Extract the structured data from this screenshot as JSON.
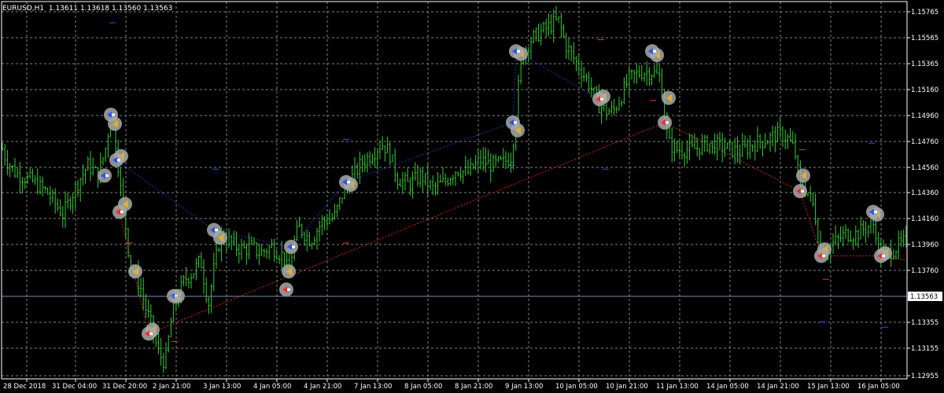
{
  "header": {
    "symbol": "EURUSD,H1",
    "ohlc": "1.13611 1.13618 1.13560 1.13563"
  },
  "colors": {
    "background": "#000000",
    "grid": "#7f7f7f",
    "frame": "#ffffff",
    "candle": "#33cc33",
    "current_price_line": "#7f8fa8",
    "buy_marker": "#2255ff",
    "sell_marker": "#ff2a2a",
    "badge": "#a9a9a9",
    "buy_trend": "#2233aa",
    "sell_trend": "#cc2222"
  },
  "chart_data": {
    "type": "candlestick",
    "title": "",
    "xlabel": "",
    "ylabel": "",
    "ylim": [
      1.1295,
      1.1585
    ],
    "y_ticks": [
      "1.15765",
      "1.15565",
      "1.15365",
      "1.15160",
      "1.14960",
      "1.14760",
      "1.14560",
      "1.14360",
      "1.14160",
      "1.13960",
      "1.13760",
      "1.13355",
      "1.13155",
      "1.12955"
    ],
    "current_price": "1.13563",
    "x_ticks": [
      "28 Dec 2018",
      "31 Dec 04:00",
      "31 Dec 20:00",
      "2 Jan 21:00",
      "3 Jan 13:00",
      "4 Jan 05:00",
      "4 Jan 21:00",
      "7 Jan 13:00",
      "8 Jan 05:00",
      "8 Jan 21:00",
      "9 Jan 13:00",
      "10 Jan 05:00",
      "10 Jan 21:00",
      "11 Jan 13:00",
      "14 Jan 05:00",
      "14 Jan 21:00",
      "15 Jan 13:00",
      "16 Jan 05:00"
    ],
    "series": [
      {
        "values": [
          [
            1,
            1.1474
          ],
          [
            8,
            1.1462
          ],
          [
            20,
            1.1452
          ],
          [
            40,
            1.1446
          ],
          [
            60,
            1.1437
          ],
          [
            80,
            1.142
          ],
          [
            100,
            1.1446
          ],
          [
            112,
            1.1458
          ],
          [
            125,
            1.145
          ],
          [
            135,
            1.1473
          ],
          [
            140,
            1.1494
          ],
          [
            145,
            1.1486
          ],
          [
            150,
            1.146
          ],
          [
            155,
            1.143
          ],
          [
            160,
            1.141
          ],
          [
            165,
            1.1382
          ],
          [
            170,
            1.1375
          ],
          [
            178,
            1.1365
          ],
          [
            185,
            1.1348
          ],
          [
            195,
            1.133
          ],
          [
            200,
            1.1315
          ],
          [
            210,
            1.1305
          ],
          [
            218,
            1.134
          ],
          [
            225,
            1.1355
          ],
          [
            235,
            1.137
          ],
          [
            245,
            1.1375
          ],
          [
            255,
            1.1385
          ],
          [
            265,
            1.135
          ],
          [
            272,
            1.1378
          ],
          [
            280,
            1.1403
          ],
          [
            290,
            1.14
          ],
          [
            300,
            1.1395
          ],
          [
            310,
            1.1393
          ],
          [
            320,
            1.1395
          ],
          [
            330,
            1.139
          ],
          [
            345,
            1.1395
          ],
          [
            360,
            1.1388
          ],
          [
            368,
            1.1372
          ],
          [
            372,
            1.1395
          ],
          [
            380,
            1.141
          ],
          [
            395,
            1.14
          ],
          [
            410,
            1.1415
          ],
          [
            425,
            1.1418
          ],
          [
            435,
            1.1435
          ],
          [
            445,
            1.1446
          ],
          [
            460,
            1.146
          ],
          [
            475,
            1.1468
          ],
          [
            485,
            1.1475
          ],
          [
            495,
            1.1468
          ],
          [
            505,
            1.1448
          ],
          [
            520,
            1.1443
          ],
          [
            535,
            1.145
          ],
          [
            550,
            1.144
          ],
          [
            565,
            1.1445
          ],
          [
            580,
            1.1455
          ],
          [
            595,
            1.1452
          ],
          [
            610,
            1.1462
          ],
          [
            625,
            1.1458
          ],
          [
            640,
            1.146
          ],
          [
            650,
            1.1465
          ],
          [
            655,
            1.1492
          ],
          [
            660,
            1.1525
          ],
          [
            665,
            1.1545
          ],
          [
            675,
            1.1555
          ],
          [
            690,
            1.1562
          ],
          [
            700,
            1.1566
          ],
          [
            710,
            1.157
          ],
          [
            720,
            1.155
          ],
          [
            735,
            1.1535
          ],
          [
            750,
            1.152
          ],
          [
            760,
            1.1505
          ],
          [
            770,
            1.15
          ],
          [
            780,
            1.15
          ],
          [
            790,
            1.1512
          ],
          [
            800,
            1.1525
          ],
          [
            815,
            1.153
          ],
          [
            830,
            1.153
          ],
          [
            840,
            1.1525
          ],
          [
            845,
            1.1495
          ],
          [
            850,
            1.1475
          ],
          [
            860,
            1.147
          ],
          [
            880,
            1.147
          ],
          [
            900,
            1.1475
          ],
          [
            920,
            1.1472
          ],
          [
            940,
            1.1468
          ],
          [
            960,
            1.1475
          ],
          [
            975,
            1.1478
          ],
          [
            990,
            1.1482
          ],
          [
            1000,
            1.148
          ],
          [
            1010,
            1.147
          ],
          [
            1018,
            1.1438
          ],
          [
            1025,
            1.144
          ],
          [
            1035,
            1.1425
          ],
          [
            1042,
            1.1395
          ],
          [
            1050,
            1.1393
          ],
          [
            1060,
            1.1398
          ],
          [
            1075,
            1.1405
          ],
          [
            1090,
            1.1405
          ],
          [
            1100,
            1.141
          ],
          [
            1112,
            1.1413
          ],
          [
            1118,
            1.1388
          ],
          [
            1128,
            1.139
          ],
          [
            1140,
            1.1395
          ],
          [
            1153,
            1.14
          ]
        ]
      }
    ],
    "buy_markers": [
      [
        141,
        1.1497
      ],
      [
        148,
        1.1462
      ],
      [
        133,
        1.145
      ],
      [
        272,
        1.1408
      ],
      [
        221,
        1.1357
      ],
      [
        440,
        1.1445
      ],
      [
        370,
        1.1395
      ],
      [
        656,
        1.1546
      ],
      [
        652,
        1.1491
      ],
      [
        829,
        1.1546
      ],
      [
        1110,
        1.1422
      ]
    ],
    "sell_markers": [
      [
        152,
        1.1422
      ],
      [
        189,
        1.1328
      ],
      [
        364,
        1.1362
      ],
      [
        762,
        1.1509
      ],
      [
        845,
        1.1491
      ],
      [
        1017,
        1.1438
      ],
      [
        1044,
        1.1388
      ],
      [
        1120,
        1.1388
      ]
    ],
    "close_markers": [
      [
        146,
        1.149
      ],
      [
        154,
        1.1465
      ],
      [
        159,
        1.1428
      ],
      [
        172,
        1.1376
      ],
      [
        194,
        1.1331
      ],
      [
        280,
        1.1402
      ],
      [
        226,
        1.1357
      ],
      [
        367,
        1.1376
      ],
      [
        446,
        1.1443
      ],
      [
        662,
        1.1544
      ],
      [
        658,
        1.1485
      ],
      [
        767,
        1.1511
      ],
      [
        835,
        1.1543
      ],
      [
        850,
        1.151
      ],
      [
        1021,
        1.145
      ],
      [
        1048,
        1.1393
      ],
      [
        1115,
        1.142
      ],
      [
        1125,
        1.139
      ]
    ],
    "buy_trend": [
      [
        148,
        1.1462
      ],
      [
        272,
        1.1408
      ],
      [
        370,
        1.1395
      ],
      [
        440,
        1.1445
      ],
      [
        652,
        1.1491
      ],
      [
        656,
        1.1546
      ],
      [
        762,
        1.1509
      ]
    ],
    "sell_trend": [
      [
        152,
        1.1422
      ],
      [
        189,
        1.1328
      ],
      [
        845,
        1.1491
      ],
      [
        1017,
        1.1438
      ],
      [
        1044,
        1.1388
      ],
      [
        1120,
        1.1388
      ],
      [
        1150,
        1.1385
      ]
    ],
    "grid": true
  }
}
